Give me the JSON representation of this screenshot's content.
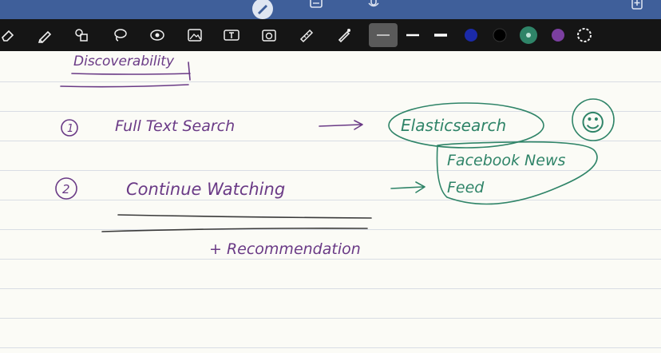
{
  "top_bar": {
    "icons": [
      "pen-mode-icon",
      "document-icon",
      "microphone-icon",
      "add-page-icon"
    ],
    "accent": "#3f5f9a"
  },
  "toolbar": {
    "tools": [
      "eraser-icon",
      "highlighter-icon",
      "shapes-icon",
      "lasso-icon",
      "laser-pointer-icon",
      "image-icon",
      "text-box-icon",
      "camera-icon",
      "ruler-icon",
      "pen-icon"
    ],
    "stroke_widths": [
      "thin",
      "medium",
      "thick"
    ],
    "selected_stroke": "thin",
    "colors": [
      "#1b2aa8",
      "#000000",
      "#2f8468",
      "#7b3fa0"
    ],
    "selected_color": "#2f8468"
  },
  "notes": {
    "heading": "Discoverability",
    "item1_number": "1",
    "item1_text": "Full Text Search",
    "item1_result": "Elasticsearch",
    "smiley": "☺",
    "item2_number": "2",
    "item2_text": "Continue Watching",
    "item2_result_line1": "Facebook News",
    "item2_result_line2": "Feed",
    "item2_note": "+ Recommendation",
    "ink_colors": {
      "purple": "#6a3a86",
      "green": "#2f8468"
    }
  }
}
